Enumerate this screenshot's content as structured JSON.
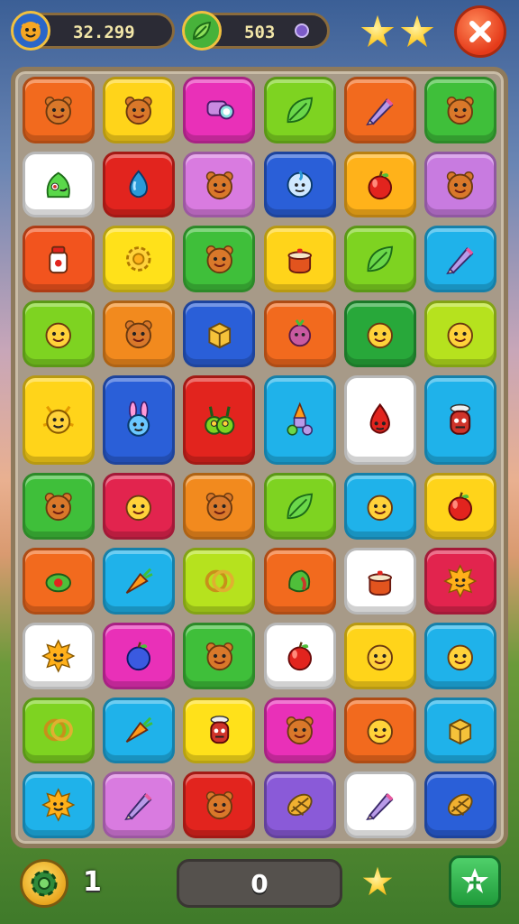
{
  "hud": {
    "score": "32.299",
    "secondary_value": "503",
    "stars_earned": 2,
    "close_icon": "close-icon"
  },
  "board": {
    "rows": 10,
    "cols": 6,
    "row_heights": [
      1,
      1,
      1,
      1,
      1.35,
      1,
      1,
      1,
      1,
      1
    ],
    "tiles": [
      [
        {
          "bg": "#f26a1e",
          "icon": "bear-face"
        },
        {
          "bg": "#ffd41a",
          "icon": "bear-face"
        },
        {
          "bg": "#e930b8",
          "icon": "scroll-lens"
        },
        {
          "bg": "#7ed321",
          "icon": "leaf"
        },
        {
          "bg": "#f26a1e",
          "icon": "pencil"
        },
        {
          "bg": "#3fbf3a",
          "icon": "bear-face"
        }
      ],
      [
        {
          "bg": "#ffffff",
          "icon": "slime-monster"
        },
        {
          "bg": "#e2241e",
          "icon": "water-drop"
        },
        {
          "bg": "#d97be0",
          "icon": "bear-face"
        },
        {
          "bg": "#2a5fd8",
          "icon": "moon-face"
        },
        {
          "bg": "#ffb21a",
          "icon": "apple"
        },
        {
          "bg": "#c87be0",
          "icon": "bear-face"
        }
      ],
      [
        {
          "bg": "#f2541e",
          "icon": "jar"
        },
        {
          "bg": "#ffe11a",
          "icon": "sun-gear"
        },
        {
          "bg": "#3fbf3a",
          "icon": "bear-face"
        },
        {
          "bg": "#ffd41a",
          "icon": "pot"
        },
        {
          "bg": "#7ed321",
          "icon": "leaf"
        },
        {
          "bg": "#1fb2ea",
          "icon": "pencil"
        }
      ],
      [
        {
          "bg": "#7ed321",
          "icon": "smiley"
        },
        {
          "bg": "#f28a1e",
          "icon": "bear-face"
        },
        {
          "bg": "#2a5fd8",
          "icon": "box"
        },
        {
          "bg": "#f26a1e",
          "icon": "radish"
        },
        {
          "bg": "#28a83a",
          "icon": "smiley"
        },
        {
          "bg": "#b6e21e",
          "icon": "smiley"
        }
      ],
      [
        {
          "bg": "#ffd41a",
          "icon": "sun-creature"
        },
        {
          "bg": "#2a5fd8",
          "icon": "bunny"
        },
        {
          "bg": "#e2241e",
          "icon": "worm-monster"
        },
        {
          "bg": "#1fb2ea",
          "icon": "rocket"
        },
        {
          "bg": "#ffffff",
          "icon": "red-drop"
        },
        {
          "bg": "#1fb2ea",
          "icon": "red-robot"
        }
      ],
      [
        {
          "bg": "#3fbf3a",
          "icon": "bear-face"
        },
        {
          "bg": "#e2244e",
          "icon": "smiley"
        },
        {
          "bg": "#f28a1e",
          "icon": "bear-face"
        },
        {
          "bg": "#7ed321",
          "icon": "leaf"
        },
        {
          "bg": "#1fb2ea",
          "icon": "smiley"
        },
        {
          "bg": "#ffd41a",
          "icon": "apple"
        }
      ],
      [
        {
          "bg": "#f26a1e",
          "icon": "olive"
        },
        {
          "bg": "#1fb2ea",
          "icon": "carrot"
        },
        {
          "bg": "#b6e21e",
          "icon": "rings"
        },
        {
          "bg": "#f26a1e",
          "icon": "green-fruit"
        },
        {
          "bg": "#ffffff",
          "icon": "pot"
        },
        {
          "bg": "#e2244e",
          "icon": "sun-smiley"
        }
      ],
      [
        {
          "bg": "#ffffff",
          "icon": "sun-smiley"
        },
        {
          "bg": "#e930b8",
          "icon": "blue-apple"
        },
        {
          "bg": "#3fbf3a",
          "icon": "bear-face"
        },
        {
          "bg": "#ffffff",
          "icon": "apple"
        },
        {
          "bg": "#ffd41a",
          "icon": "smiley"
        },
        {
          "bg": "#1fb2ea",
          "icon": "smiley"
        }
      ],
      [
        {
          "bg": "#7ed321",
          "icon": "rings"
        },
        {
          "bg": "#1fb2ea",
          "icon": "carrot"
        },
        {
          "bg": "#ffe11a",
          "icon": "red-robot"
        },
        {
          "bg": "#e930b8",
          "icon": "bear-face"
        },
        {
          "bg": "#f26a1e",
          "icon": "smiley"
        },
        {
          "bg": "#1fb2ea",
          "icon": "box"
        }
      ],
      [
        {
          "bg": "#1fb2ea",
          "icon": "sun-smiley"
        },
        {
          "bg": "#d97be0",
          "icon": "pencil"
        },
        {
          "bg": "#e2241e",
          "icon": "bear-face"
        },
        {
          "bg": "#8a5ad8",
          "icon": "shell"
        },
        {
          "bg": "#ffffff",
          "icon": "pencil"
        },
        {
          "bg": "#2a5fd8",
          "icon": "shell"
        }
      ]
    ]
  },
  "footer": {
    "count": "1",
    "center_value": "0",
    "plus_icon": "star-plus-icon",
    "gear_icon": "gear-icon"
  }
}
